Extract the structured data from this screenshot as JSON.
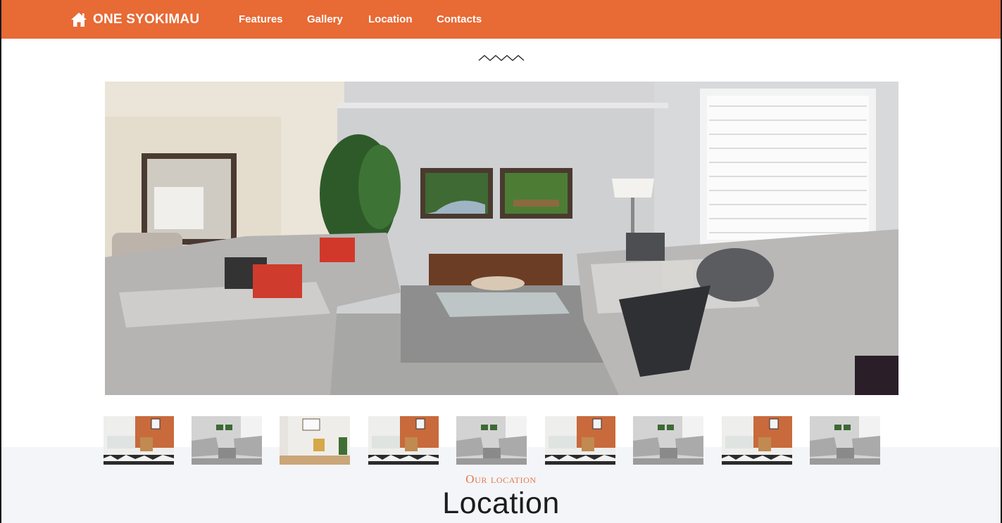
{
  "navbar": {
    "brand": "ONE SYOKIMAU",
    "links": [
      "Features",
      "Gallery",
      "Location",
      "Contacts"
    ],
    "bg": "#e86a35"
  },
  "gallery": {
    "main_image": "living-room-gray-sofas",
    "thumbnails": [
      "dining-room-brick-wall",
      "living-room-gray-sofas",
      "reading-nook-armchair",
      "dining-room-brick-wall",
      "living-room-gray-sofas",
      "dining-room-brick-wall",
      "living-room-gray-sofas",
      "dining-room-brick-wall",
      "living-room-gray-sofas"
    ]
  },
  "location": {
    "kicker": "Our location",
    "title": "Location"
  },
  "icons": {
    "brand": "home-icon",
    "divider": "zigzag-divider-icon"
  },
  "colors": {
    "accent": "#e86a35",
    "section_bg": "#f4f5f9"
  }
}
